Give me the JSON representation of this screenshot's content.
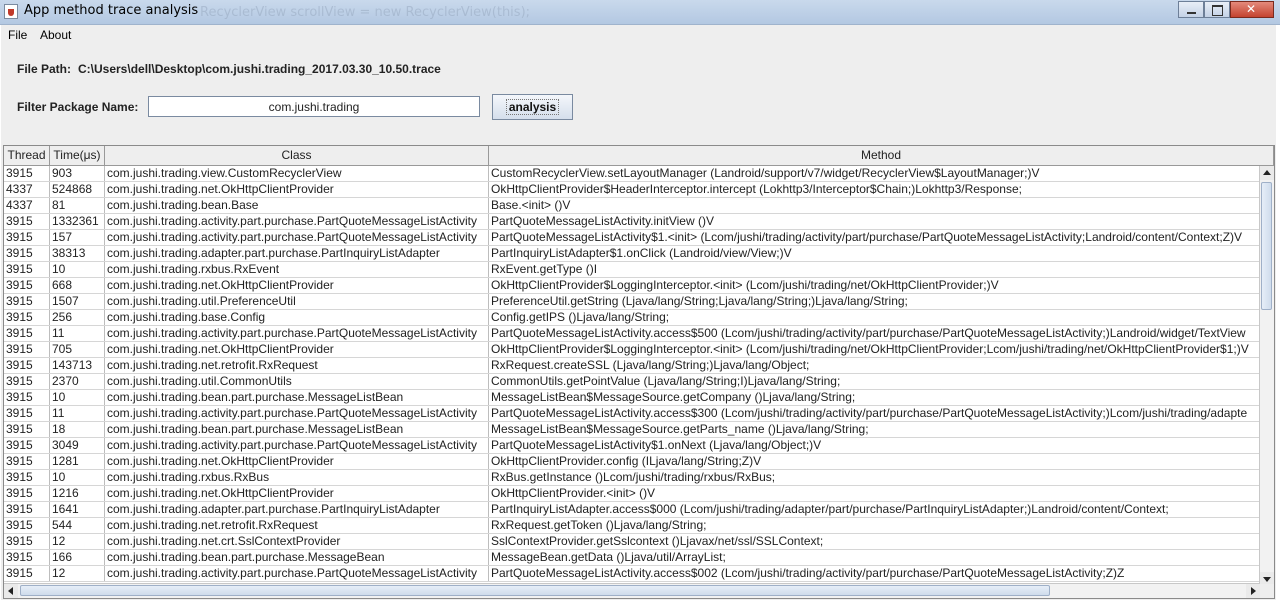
{
  "window": {
    "title": "App method trace analysis",
    "background_text": "RecyclerView  scrollView = new RecyclerView(this);"
  },
  "menu": [
    "File",
    "About"
  ],
  "file_path": {
    "label": "File Path:",
    "value": "C:\\Users\\dell\\Desktop\\com.jushi.trading_2017.03.30_10.50.trace"
  },
  "filter": {
    "label": "Filter Package Name:",
    "value": "com.jushi.trading",
    "button_label": "analysis"
  },
  "table": {
    "columns": [
      "Thread",
      "Time(μs)",
      "Class",
      "Method"
    ],
    "rows": [
      [
        "3915",
        "903",
        "com.jushi.trading.view.CustomRecyclerView",
        "CustomRecyclerView.setLayoutManager (Landroid/support/v7/widget/RecyclerView$LayoutManager;)V"
      ],
      [
        "4337",
        "524868",
        "com.jushi.trading.net.OkHttpClientProvider",
        "OkHttpClientProvider$HeaderInterceptor.intercept (Lokhttp3/Interceptor$Chain;)Lokhttp3/Response;"
      ],
      [
        "4337",
        "81",
        "com.jushi.trading.bean.Base",
        "Base.<init> ()V"
      ],
      [
        "3915",
        "1332361",
        "com.jushi.trading.activity.part.purchase.PartQuoteMessageListActivity",
        "PartQuoteMessageListActivity.initView ()V"
      ],
      [
        "3915",
        "157",
        "com.jushi.trading.activity.part.purchase.PartQuoteMessageListActivity",
        "PartQuoteMessageListActivity$1.<init> (Lcom/jushi/trading/activity/part/purchase/PartQuoteMessageListActivity;Landroid/content/Context;Z)V"
      ],
      [
        "3915",
        "38313",
        "com.jushi.trading.adapter.part.purchase.PartInquiryListAdapter",
        "PartInquiryListAdapter$1.onClick (Landroid/view/View;)V"
      ],
      [
        "3915",
        "10",
        "com.jushi.trading.rxbus.RxEvent",
        "RxEvent.getType ()I"
      ],
      [
        "3915",
        "668",
        "com.jushi.trading.net.OkHttpClientProvider",
        "OkHttpClientProvider$LoggingInterceptor.<init> (Lcom/jushi/trading/net/OkHttpClientProvider;)V"
      ],
      [
        "3915",
        "1507",
        "com.jushi.trading.util.PreferenceUtil",
        "PreferenceUtil.getString (Ljava/lang/String;Ljava/lang/String;)Ljava/lang/String;"
      ],
      [
        "3915",
        "256",
        "com.jushi.trading.base.Config",
        "Config.getIPS ()Ljava/lang/String;"
      ],
      [
        "3915",
        "11",
        "com.jushi.trading.activity.part.purchase.PartQuoteMessageListActivity",
        "PartQuoteMessageListActivity.access$500 (Lcom/jushi/trading/activity/part/purchase/PartQuoteMessageListActivity;)Landroid/widget/TextView"
      ],
      [
        "3915",
        "705",
        "com.jushi.trading.net.OkHttpClientProvider",
        "OkHttpClientProvider$LoggingInterceptor.<init> (Lcom/jushi/trading/net/OkHttpClientProvider;Lcom/jushi/trading/net/OkHttpClientProvider$1;)V"
      ],
      [
        "3915",
        "143713",
        "com.jushi.trading.net.retrofit.RxRequest",
        "RxRequest.createSSL (Ljava/lang/String;)Ljava/lang/Object;"
      ],
      [
        "3915",
        "2370",
        "com.jushi.trading.util.CommonUtils",
        "CommonUtils.getPointValue (Ljava/lang/String;I)Ljava/lang/String;"
      ],
      [
        "3915",
        "10",
        "com.jushi.trading.bean.part.purchase.MessageListBean",
        "MessageListBean$MessageSource.getCompany ()Ljava/lang/String;"
      ],
      [
        "3915",
        "11",
        "com.jushi.trading.activity.part.purchase.PartQuoteMessageListActivity",
        "PartQuoteMessageListActivity.access$300 (Lcom/jushi/trading/activity/part/purchase/PartQuoteMessageListActivity;)Lcom/jushi/trading/adapte"
      ],
      [
        "3915",
        "18",
        "com.jushi.trading.bean.part.purchase.MessageListBean",
        "MessageListBean$MessageSource.getParts_name ()Ljava/lang/String;"
      ],
      [
        "3915",
        "3049",
        "com.jushi.trading.activity.part.purchase.PartQuoteMessageListActivity",
        "PartQuoteMessageListActivity$1.onNext (Ljava/lang/Object;)V"
      ],
      [
        "3915",
        "1281",
        "com.jushi.trading.net.OkHttpClientProvider",
        "OkHttpClientProvider.config (ILjava/lang/String;Z)V"
      ],
      [
        "3915",
        "10",
        "com.jushi.trading.rxbus.RxBus",
        "RxBus.getInstance ()Lcom/jushi/trading/rxbus/RxBus;"
      ],
      [
        "3915",
        "1216",
        "com.jushi.trading.net.OkHttpClientProvider",
        "OkHttpClientProvider.<init> ()V"
      ],
      [
        "3915",
        "1641",
        "com.jushi.trading.adapter.part.purchase.PartInquiryListAdapter",
        "PartInquiryListAdapter.access$000 (Lcom/jushi/trading/adapter/part/purchase/PartInquiryListAdapter;)Landroid/content/Context;"
      ],
      [
        "3915",
        "544",
        "com.jushi.trading.net.retrofit.RxRequest",
        "RxRequest.getToken ()Ljava/lang/String;"
      ],
      [
        "3915",
        "12",
        "com.jushi.trading.net.crt.SslContextProvider",
        "SslContextProvider.getSslcontext ()Ljavax/net/ssl/SSLContext;"
      ],
      [
        "3915",
        "166",
        "com.jushi.trading.bean.part.purchase.MessageBean",
        "MessageBean.getData ()Ljava/util/ArrayList;"
      ],
      [
        "3915",
        "12",
        "com.jushi.trading.activity.part.purchase.PartQuoteMessageListActivity",
        "PartQuoteMessageListActivity.access$002 (Lcom/jushi/trading/activity/part/purchase/PartQuoteMessageListActivity;Z)Z"
      ]
    ]
  }
}
